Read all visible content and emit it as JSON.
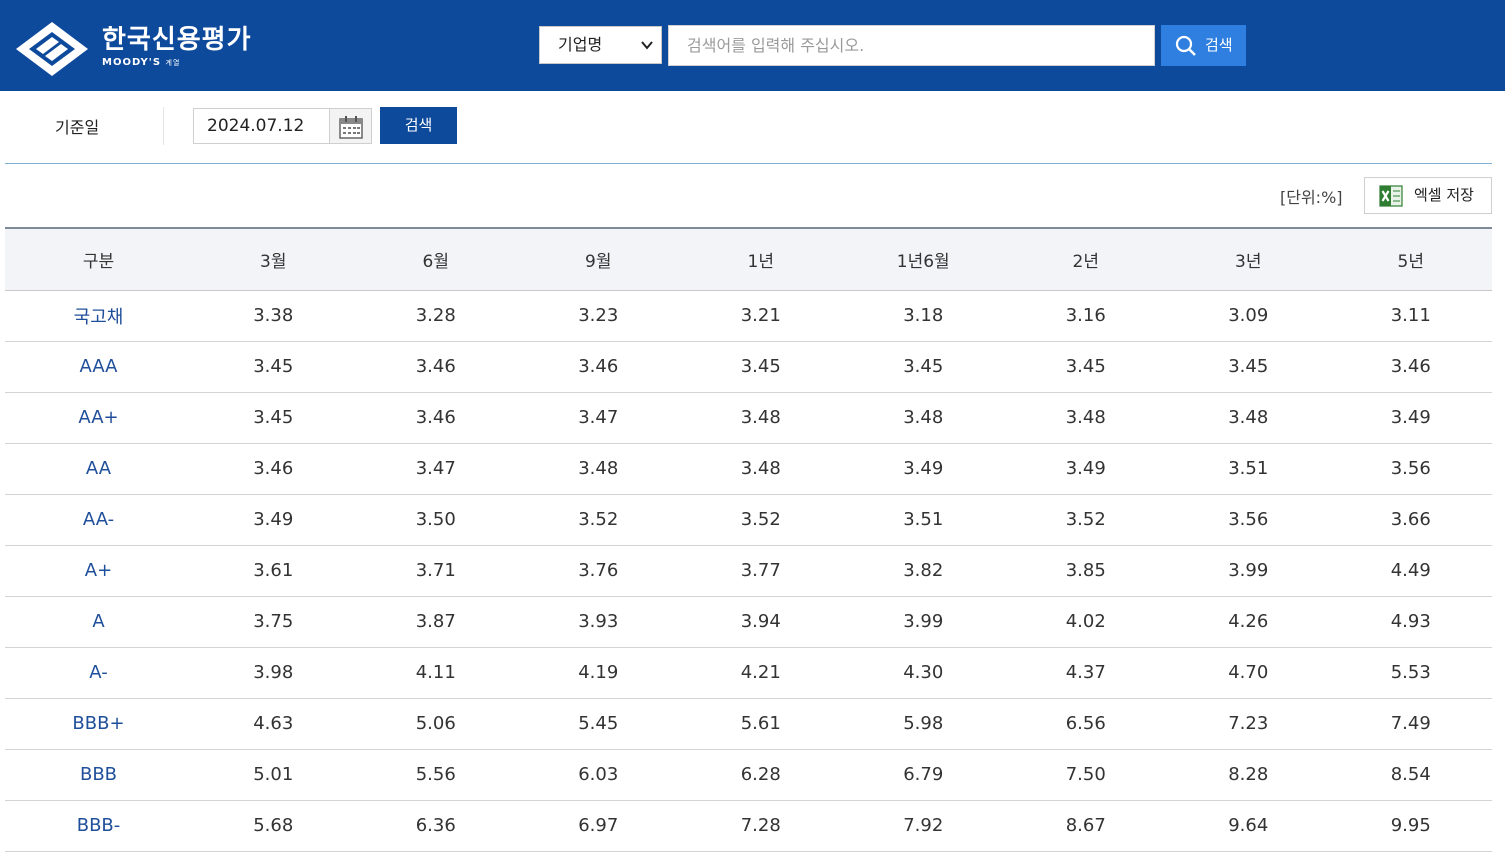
{
  "header": {
    "brand_name": "한국신용평가",
    "brand_sub": "MOODY'S",
    "brand_sub_small": "계열",
    "search_select_value": "기업명",
    "search_placeholder": "검색어를 입력해 주십시오.",
    "search_button": "검색"
  },
  "filter": {
    "date_label": "기준일",
    "date_value": "2024.07.12",
    "search_button": "검색"
  },
  "toolbar": {
    "unit": "[단위:%]",
    "excel_button": "엑셀 저장"
  },
  "table": {
    "columns": [
      "구분",
      "3월",
      "6월",
      "9월",
      "1년",
      "1년6월",
      "2년",
      "3년",
      "5년"
    ],
    "rows": [
      {
        "grade": "국고채",
        "values": [
          "3.38",
          "3.28",
          "3.23",
          "3.21",
          "3.18",
          "3.16",
          "3.09",
          "3.11"
        ]
      },
      {
        "grade": "AAA",
        "values": [
          "3.45",
          "3.46",
          "3.46",
          "3.45",
          "3.45",
          "3.45",
          "3.45",
          "3.46"
        ]
      },
      {
        "grade": "AA+",
        "values": [
          "3.45",
          "3.46",
          "3.47",
          "3.48",
          "3.48",
          "3.48",
          "3.48",
          "3.49"
        ]
      },
      {
        "grade": "AA",
        "values": [
          "3.46",
          "3.47",
          "3.48",
          "3.48",
          "3.49",
          "3.49",
          "3.51",
          "3.56"
        ]
      },
      {
        "grade": "AA-",
        "values": [
          "3.49",
          "3.50",
          "3.52",
          "3.52",
          "3.51",
          "3.52",
          "3.56",
          "3.66"
        ]
      },
      {
        "grade": "A+",
        "values": [
          "3.61",
          "3.71",
          "3.76",
          "3.77",
          "3.82",
          "3.85",
          "3.99",
          "4.49"
        ]
      },
      {
        "grade": "A",
        "values": [
          "3.75",
          "3.87",
          "3.93",
          "3.94",
          "3.99",
          "4.02",
          "4.26",
          "4.93"
        ]
      },
      {
        "grade": "A-",
        "values": [
          "3.98",
          "4.11",
          "4.19",
          "4.21",
          "4.30",
          "4.37",
          "4.70",
          "5.53"
        ]
      },
      {
        "grade": "BBB+",
        "values": [
          "4.63",
          "5.06",
          "5.45",
          "5.61",
          "5.98",
          "6.56",
          "7.23",
          "7.49"
        ]
      },
      {
        "grade": "BBB",
        "values": [
          "5.01",
          "5.56",
          "6.03",
          "6.28",
          "6.79",
          "7.50",
          "8.28",
          "8.54"
        ]
      },
      {
        "grade": "BBB-",
        "values": [
          "5.68",
          "6.36",
          "6.97",
          "7.28",
          "7.92",
          "8.67",
          "9.64",
          "9.95"
        ]
      }
    ]
  },
  "colors": {
    "header_bg": "#0d4a9c",
    "search_button_bg": "#2f7fe0",
    "grade_text": "#1f4f9a",
    "table_header_bg": "#f2f4f7"
  },
  "icons": [
    "logo-icon",
    "chevron-down-icon",
    "search-icon",
    "calendar-icon",
    "excel-icon"
  ]
}
